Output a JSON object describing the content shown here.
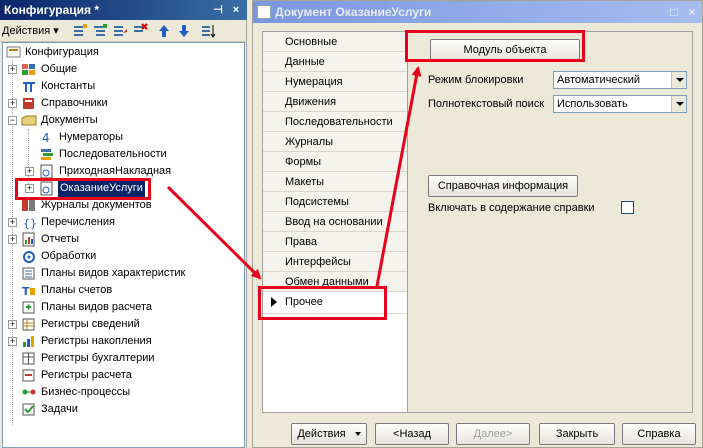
{
  "config_panel": {
    "title": "Конфигурация *",
    "pin_glyph": "⊣",
    "close_glyph": "×",
    "actions_label": "Действия ▾",
    "tree": [
      {
        "label": "Конфигурация",
        "icon": "config-icon"
      },
      {
        "label": "Общие",
        "icon": "common-icon"
      },
      {
        "label": "Константы",
        "icon": "constants-icon"
      },
      {
        "label": "Справочники",
        "icon": "catalogs-icon"
      },
      {
        "label": "Документы",
        "icon": "documents-icon"
      },
      {
        "label": "Нумераторы",
        "icon": "numerators-icon"
      },
      {
        "label": "Последовательности",
        "icon": "sequences-icon"
      },
      {
        "label": "ПриходнаяНакладная",
        "icon": "document-icon"
      },
      {
        "label": "ОказаниеУслуги",
        "icon": "document-icon",
        "selected": true
      },
      {
        "label": "Журналы документов",
        "icon": "journals-icon"
      },
      {
        "label": "Перечисления",
        "icon": "enums-icon"
      },
      {
        "label": "Отчеты",
        "icon": "reports-icon"
      },
      {
        "label": "Обработки",
        "icon": "processing-icon"
      },
      {
        "label": "Планы видов характеристик",
        "icon": "char-plans-icon"
      },
      {
        "label": "Планы счетов",
        "icon": "accounts-icon"
      },
      {
        "label": "Планы видов расчета",
        "icon": "calc-plans-icon"
      },
      {
        "label": "Регистры сведений",
        "icon": "info-registers-icon"
      },
      {
        "label": "Регистры накопления",
        "icon": "accum-registers-icon"
      },
      {
        "label": "Регистры бухгалтерии",
        "icon": "account-registers-icon"
      },
      {
        "label": "Регистры расчета",
        "icon": "calc-registers-icon"
      },
      {
        "label": "Бизнес-процессы",
        "icon": "business-process-icon"
      },
      {
        "label": "Задачи",
        "icon": "tasks-icon"
      }
    ]
  },
  "document_window": {
    "title": "Документ ОказаниеУслуги",
    "max_glyph": "□",
    "close_glyph": "×",
    "tabs": [
      "Основные",
      "Данные",
      "Нумерация",
      "Движения",
      "Последовательности",
      "Журналы",
      "Формы",
      "Макеты",
      "Подсистемы",
      "Ввод на основании",
      "Права",
      "Интерфейсы",
      "Обмен данными",
      "Прочее"
    ],
    "active_tab": "Прочее",
    "module_button": "Модуль объекта",
    "lock_mode_label": "Режим блокировки",
    "lock_mode_value": "Автоматический",
    "fulltext_label": "Полнотекстовый поиск",
    "fulltext_value": "Использовать",
    "help_button": "Справочная информация",
    "include_help_label": "Включать в содержание справки",
    "include_help_checked": false,
    "bottom": {
      "actions": "Действия",
      "back": "<Назад",
      "next": "Далее>",
      "close": "Закрыть",
      "help": "Справка"
    }
  },
  "colors": {
    "highlight": "#e8001c",
    "title_active": "#0a246a",
    "title_inactive": "#7a96df"
  }
}
